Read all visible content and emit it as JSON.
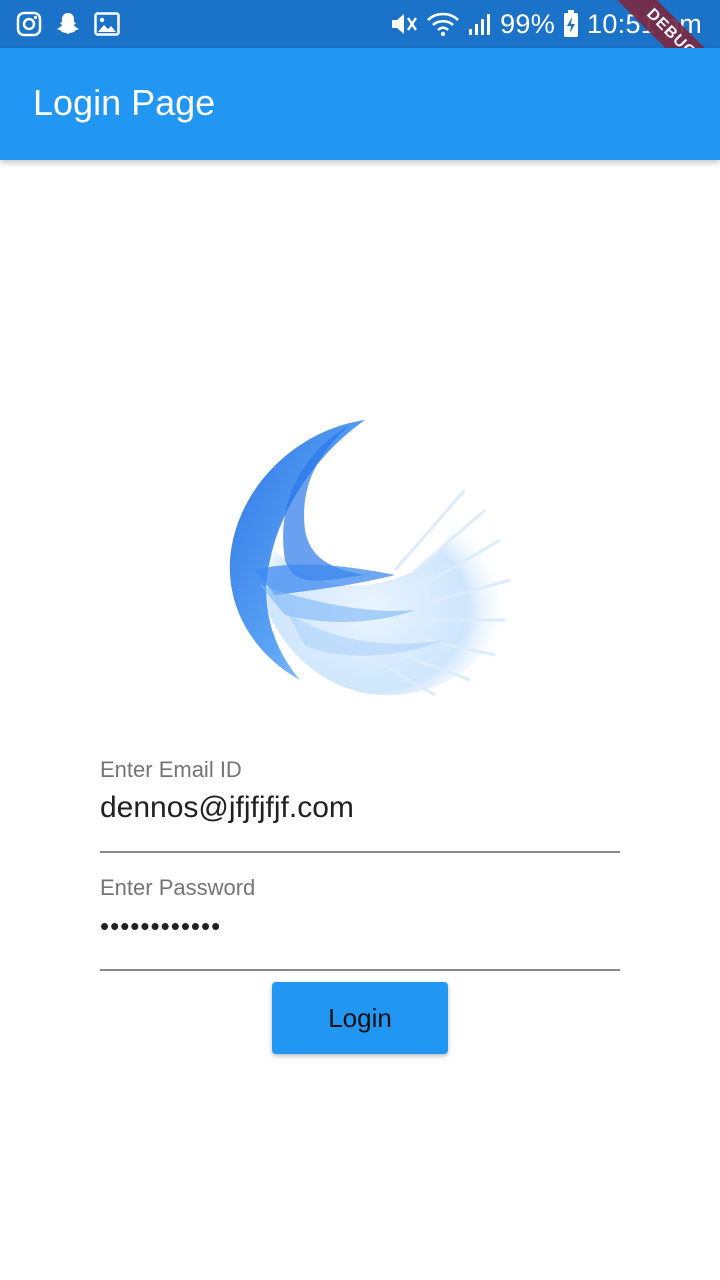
{
  "status_bar": {
    "battery_percent": "99%",
    "time": "10:51 pm",
    "left_icons": [
      "instagram-icon",
      "snapchat-icon",
      "gallery-icon"
    ],
    "right_icons": [
      "vibrate-mute-icon",
      "wifi-icon",
      "signal-icon",
      "battery-charging-icon"
    ]
  },
  "debug_ribbon": {
    "label": "DEBUG"
  },
  "app_bar": {
    "title": "Login Page"
  },
  "form": {
    "email": {
      "label": "Enter Email ID",
      "value": "dennos@jfjfjfjf.com"
    },
    "password": {
      "label": "Enter Password",
      "masked_value": "••••••••••••"
    },
    "login_button": {
      "label": "Login"
    }
  },
  "colors": {
    "primary": "#2196f3",
    "status_bar": "#1a73c9",
    "debug_ribbon": "#7a2a43"
  }
}
